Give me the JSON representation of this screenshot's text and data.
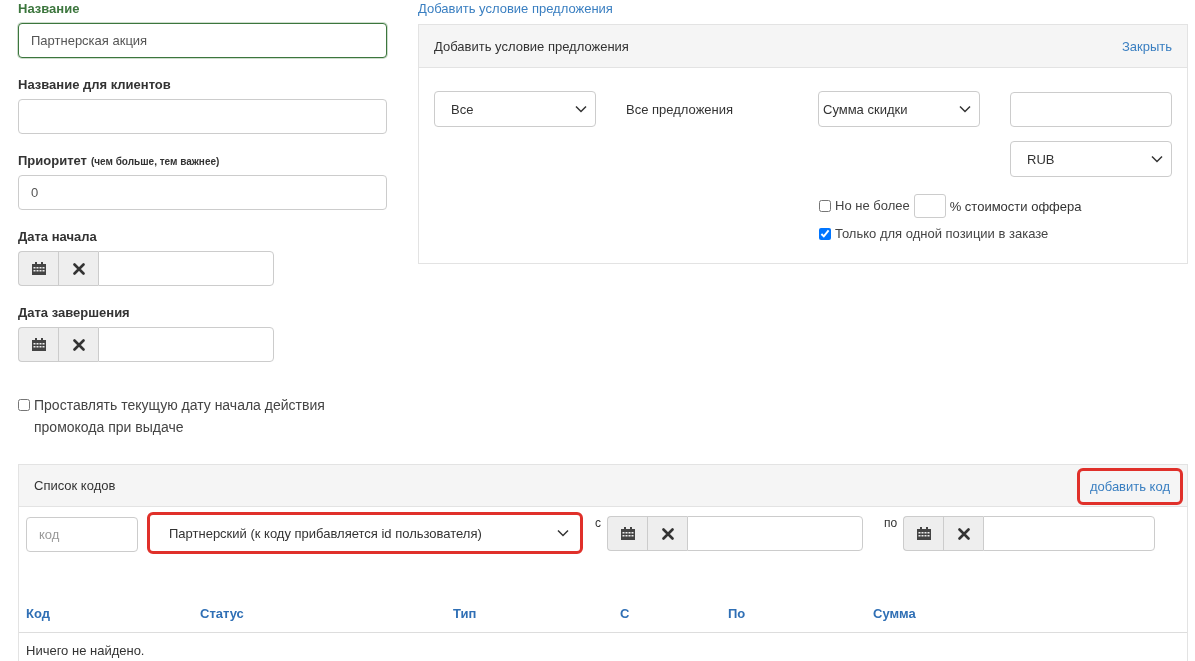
{
  "promo_form": {
    "fields": [
      {
        "kind": "text",
        "label": "Название",
        "valid": true,
        "value": "Партнерская акция"
      },
      {
        "kind": "text",
        "label": "Название для клиентов",
        "valid": false
      },
      {
        "kind": "text",
        "label": "Приоритет",
        "note": "(чем больше, тем важнее)",
        "valid": false,
        "value": "0"
      },
      {
        "kind": "date",
        "label": "Дата начала",
        "valid": false
      },
      {
        "kind": "date",
        "label": "Дата завершения",
        "valid": false
      }
    ],
    "auto_start_date": {
      "label": "Проставлять текущую дату начала действия промокода при выдаче",
      "checked": false
    }
  },
  "offer_condition": {
    "link": "Добавить условие предложения",
    "panel": {
      "title": "Добавить условие предложения",
      "close": "Закрыть",
      "scope_select": "Все",
      "scope_text": "Все предложения",
      "discount_select": "Сумма скидки",
      "currency_select": "RUB",
      "limit": {
        "label": "Но не более",
        "suffix": "% стоимости оффера",
        "checked": false
      },
      "single_item": {
        "label": "Только для одной позиции в заказе",
        "checked": true
      }
    }
  },
  "codes": {
    "title": "Список кодов",
    "add": {
      "label": "добавить код",
      "highlighted": true
    },
    "filters": {
      "code_placeholder": "код",
      "type": {
        "value": "Партнерский (к коду прибавляется id пользователя)",
        "highlighted": true
      },
      "from_label": "с",
      "to_label": "по"
    },
    "columns": [
      "Код",
      "Статус",
      "Тип",
      "С",
      "По",
      "Сумма"
    ],
    "empty": "Ничего не найдено."
  }
}
